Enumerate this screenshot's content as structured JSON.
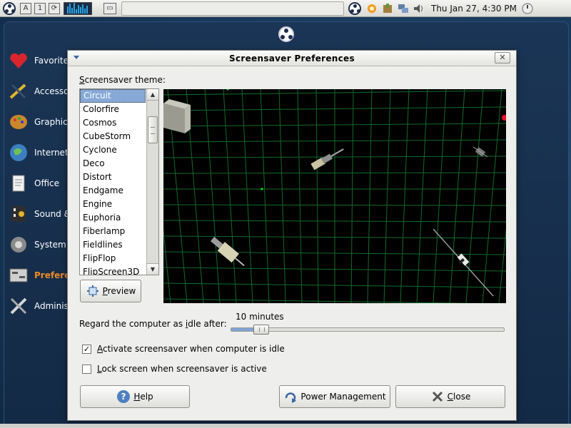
{
  "top_panel": {
    "clock": "Thu Jan 27,  4:30 PM",
    "small_button_labels": [
      "A",
      "1"
    ]
  },
  "menu": {
    "items": [
      {
        "label": "Favorites",
        "icon": "heart-icon",
        "color": "#d8262c"
      },
      {
        "label": "Accessories",
        "icon": "tools-icon",
        "color": "#3b4e6e"
      },
      {
        "label": "Graphics",
        "icon": "palette-icon",
        "color": "#c9882a"
      },
      {
        "label": "Internet",
        "icon": "globe-icon",
        "color": "#3b7fc2"
      },
      {
        "label": "Office",
        "icon": "document-icon",
        "color": "#e8e8e8"
      },
      {
        "label": "Sound & Video",
        "icon": "media-icon",
        "color": "#2e2e2e"
      },
      {
        "label": "System",
        "icon": "gear-icon",
        "color": "#777777"
      },
      {
        "label": "Preferences",
        "icon": "preferences-icon",
        "color": "#aaaaaa",
        "active": true
      },
      {
        "label": "Administration",
        "icon": "wrench-icon",
        "color": "#cccccc"
      }
    ]
  },
  "dialog": {
    "title": "Screensaver Preferences",
    "theme_label_prefix": "S",
    "theme_label_rest": "creensaver theme:",
    "themes": [
      "Circuit",
      "Colorfire",
      "Cosmos",
      "CubeStorm",
      "Cyclone",
      "Deco",
      "Distort",
      "Endgame",
      "Engine",
      "Euphoria",
      "Fiberlamp",
      "Fieldlines",
      "FlipFlop",
      "FlipScreen3D"
    ],
    "selected_theme": "Circuit",
    "preview_button": {
      "mnemonic": "P",
      "rest": "review"
    },
    "idle": {
      "label_prefix": "Regard the computer as ",
      "label_mnemonic": "i",
      "label_rest": "dle after:",
      "value_text": "10 minutes",
      "slider_fraction": 0.11
    },
    "activate_checkbox": {
      "label_prefix": "",
      "mnemonic": "A",
      "rest": "ctivate screensaver when computer is idle",
      "checked": true
    },
    "lock_checkbox": {
      "mnemonic": "L",
      "rest": "ock screen when screensaver is active",
      "checked": false
    },
    "help_button": {
      "mnemonic": "H",
      "rest": "elp"
    },
    "power_button": {
      "label": "Power Management"
    },
    "close_button": {
      "mnemonic": "C",
      "rest": "lose"
    }
  },
  "colors": {
    "accent_selection": "#86a9d5",
    "preview_grid": "#0f6b2a",
    "menu_active": "#f08a24"
  }
}
